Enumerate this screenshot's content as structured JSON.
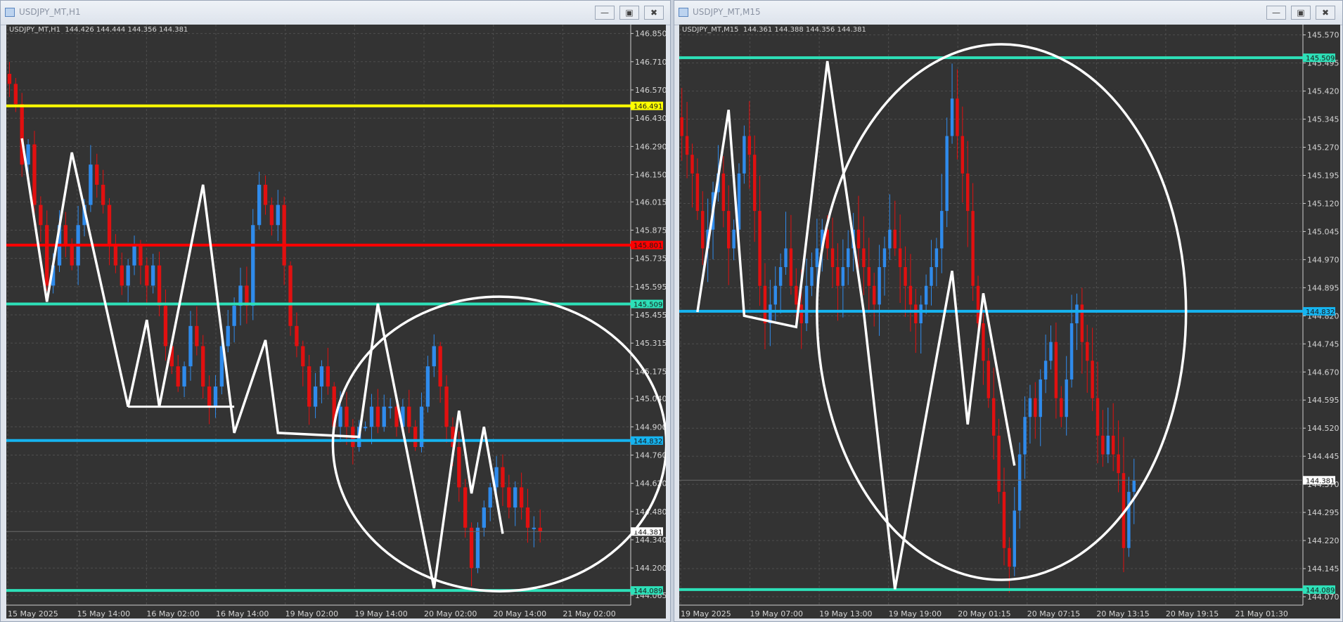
{
  "windows": [
    {
      "title": "USDJPY_MT,H1",
      "info": "USDJPY_MT,H1  144.426 144.444 144.356 144.381",
      "buttons": {
        "minimize": "—",
        "maximize": "▣",
        "close": "✖"
      },
      "chart_data": {
        "type": "candlestick",
        "symbol": "USDJPY_MT",
        "timeframe": "H1",
        "ohlc": {
          "open": 144.426,
          "high": 144.444,
          "low": 144.356,
          "close": 144.381
        },
        "y_ticks": [
          146.85,
          146.71,
          146.57,
          146.43,
          146.29,
          146.15,
          146.015,
          145.875,
          145.735,
          145.595,
          145.455,
          145.315,
          145.175,
          145.04,
          144.9,
          144.76,
          144.62,
          144.48,
          144.34,
          144.2,
          144.065
        ],
        "y_tick_labels": [
          "146.850",
          "146.710",
          "146.570",
          "146.430",
          "146.290",
          "146.150",
          "146.015",
          "145.875",
          "145.735",
          "145.595",
          "145.455",
          "145.315",
          "145.175",
          "145.040",
          "144.900",
          "144.760",
          "144.620",
          "144.480",
          "144.340",
          "144.200",
          "144.065"
        ],
        "ylim": [
          144.03,
          146.88
        ],
        "x_labels": [
          "15 May 2025",
          "15 May 14:00",
          "16 May 02:00",
          "16 May 14:00",
          "19 May 02:00",
          "19 May 14:00",
          "20 May 02:00",
          "20 May 14:00",
          "21 May 02:00"
        ],
        "candle_slots": 100,
        "closes": [
          146.6,
          146.5,
          146.2,
          146.3,
          146.0,
          145.9,
          145.6,
          145.7,
          145.9,
          145.8,
          145.7,
          145.9,
          146.0,
          146.2,
          146.1,
          146.0,
          145.8,
          145.7,
          145.6,
          145.7,
          145.8,
          145.7,
          145.6,
          145.7,
          145.5,
          145.3,
          145.2,
          145.1,
          145.2,
          145.4,
          145.3,
          145.1,
          145.0,
          145.1,
          145.3,
          145.4,
          145.5,
          145.6,
          145.5,
          145.9,
          146.1,
          146.0,
          145.9,
          146.0,
          145.7,
          145.4,
          145.3,
          145.2,
          145.0,
          145.1,
          145.2,
          145.1,
          144.9,
          145.0,
          144.9,
          144.8,
          144.9,
          144.9,
          145.0,
          144.9,
          145.0,
          145.0,
          144.9,
          145.0,
          144.9,
          144.8,
          145.0,
          145.2,
          145.3,
          145.1,
          144.9,
          144.8,
          144.6,
          144.4,
          144.2,
          144.4,
          144.5,
          144.6,
          144.7,
          144.6,
          144.5,
          144.6,
          144.5,
          144.4,
          144.4,
          144.38
        ],
        "levels": [
          {
            "price": 146.491,
            "label": "146.491",
            "color": "#ffff00"
          },
          {
            "price": 145.801,
            "label": "145.801",
            "color": "#ff0000"
          },
          {
            "price": 145.509,
            "label": "145.509",
            "color": "#2de0b8"
          },
          {
            "price": 144.832,
            "label": "144.832",
            "color": "#16b4f0"
          },
          {
            "price": 144.089,
            "label": "144.089",
            "color": "#2de0b8"
          }
        ],
        "current_price_label": "144.381",
        "current_price": 144.381,
        "zigzag": [
          [
            2,
            146.33
          ],
          [
            6,
            145.52
          ],
          [
            10,
            146.26
          ],
          [
            19,
            145.0
          ],
          [
            22,
            145.43
          ],
          [
            24,
            145.0
          ],
          [
            31,
            146.1
          ],
          [
            36,
            144.87
          ],
          [
            41,
            145.33
          ],
          [
            43,
            144.87
          ],
          [
            56,
            144.85
          ],
          [
            59,
            145.51
          ],
          [
            68,
            144.1
          ],
          [
            72,
            144.98
          ],
          [
            74,
            144.57
          ],
          [
            76,
            144.9
          ],
          [
            79,
            144.37
          ]
        ],
        "support_segment": {
          "from": 19,
          "to": 36,
          "price": 145.0
        },
        "ellipse": {
          "cx": 78.5,
          "price": 144.815,
          "rx_slots": 26.7,
          "ry_price": 0.73
        },
        "colors": {
          "background": "#333333",
          "grid": "#4e4e4e",
          "bull": "#2f8bec",
          "bear": "#e11010",
          "axis_text": "#d4d4d4"
        }
      }
    },
    {
      "title": "USDJPY_MT,M15",
      "info": "USDJPY_MT,M15  144.361 144.388 144.356 144.381",
      "buttons": {
        "minimize": "—",
        "maximize": "▣",
        "close": "✖"
      },
      "chart_data": {
        "type": "candlestick",
        "symbol": "USDJPY_MT",
        "timeframe": "M15",
        "ohlc": {
          "open": 144.361,
          "high": 144.388,
          "low": 144.356,
          "close": 144.381
        },
        "y_ticks": [
          145.57,
          145.495,
          145.42,
          145.345,
          145.27,
          145.195,
          145.12,
          145.045,
          144.97,
          144.895,
          144.82,
          144.745,
          144.67,
          144.595,
          144.52,
          144.445,
          144.37,
          144.295,
          144.22,
          144.145,
          144.07
        ],
        "y_tick_labels": [
          "145.570",
          "145.495",
          "145.420",
          "145.345",
          "145.270",
          "145.195",
          "145.120",
          "145.045",
          "144.970",
          "144.895",
          "144.820",
          "144.745",
          "144.670",
          "144.595",
          "144.520",
          "144.445",
          "144.370",
          "144.295",
          "144.220",
          "144.145",
          "144.070"
        ],
        "ylim": [
          144.055,
          145.59
        ],
        "x_labels": [
          "19 May 2025",
          "19 May 07:00",
          "19 May 13:00",
          "19 May 19:00",
          "20 May 01:15",
          "20 May 07:15",
          "20 May 13:15",
          "20 May 19:15",
          "21 May 01:30"
        ],
        "candle_slots": 120,
        "closes": [
          145.3,
          145.25,
          145.2,
          145.1,
          145.0,
          145.05,
          145.15,
          145.2,
          145.1,
          145.0,
          145.05,
          145.2,
          145.3,
          145.25,
          145.1,
          144.9,
          144.8,
          144.85,
          144.9,
          144.95,
          145.0,
          144.9,
          144.85,
          144.8,
          144.9,
          144.95,
          145.0,
          145.05,
          145.0,
          144.95,
          144.9,
          144.95,
          145.0,
          145.05,
          145.0,
          144.95,
          144.9,
          144.85,
          144.95,
          145.0,
          145.05,
          145.0,
          144.95,
          144.9,
          144.85,
          144.8,
          144.85,
          144.9,
          144.95,
          145.0,
          145.1,
          145.3,
          145.4,
          145.3,
          145.2,
          145.1,
          144.9,
          144.8,
          144.7,
          144.6,
          144.5,
          144.35,
          144.2,
          144.15,
          144.3,
          144.45,
          144.55,
          144.6,
          144.55,
          144.65,
          144.7,
          144.75,
          144.6,
          144.55,
          144.65,
          144.8,
          144.85,
          144.75,
          144.7,
          144.6,
          144.5,
          144.45,
          144.5,
          144.45,
          144.4,
          144.2,
          144.35,
          144.38
        ],
        "levels": [
          {
            "price": 145.509,
            "label": "145.509",
            "color": "#2de0b8"
          },
          {
            "price": 144.832,
            "label": "144.832",
            "color": "#16b4f0"
          },
          {
            "price": 144.089,
            "label": "144.089",
            "color": "#2de0b8"
          }
        ],
        "current_price_label": "144.381",
        "current_price": 144.381,
        "zigzag": [
          [
            3,
            144.83
          ],
          [
            9,
            145.37
          ],
          [
            12,
            144.82
          ],
          [
            22,
            144.79
          ],
          [
            28,
            145.5
          ],
          [
            35,
            144.83
          ],
          [
            41,
            144.09
          ],
          [
            52,
            144.94
          ],
          [
            55,
            144.53
          ],
          [
            58,
            144.88
          ],
          [
            64,
            144.42
          ]
        ],
        "ellipse": {
          "cx": 61.5,
          "price": 144.83,
          "rx_slots": 35.5,
          "ry_price": 0.715
        },
        "colors": {
          "background": "#333333",
          "grid": "#4e4e4e",
          "bull": "#2f8bec",
          "bear": "#e11010",
          "axis_text": "#d4d4d4"
        }
      }
    }
  ]
}
